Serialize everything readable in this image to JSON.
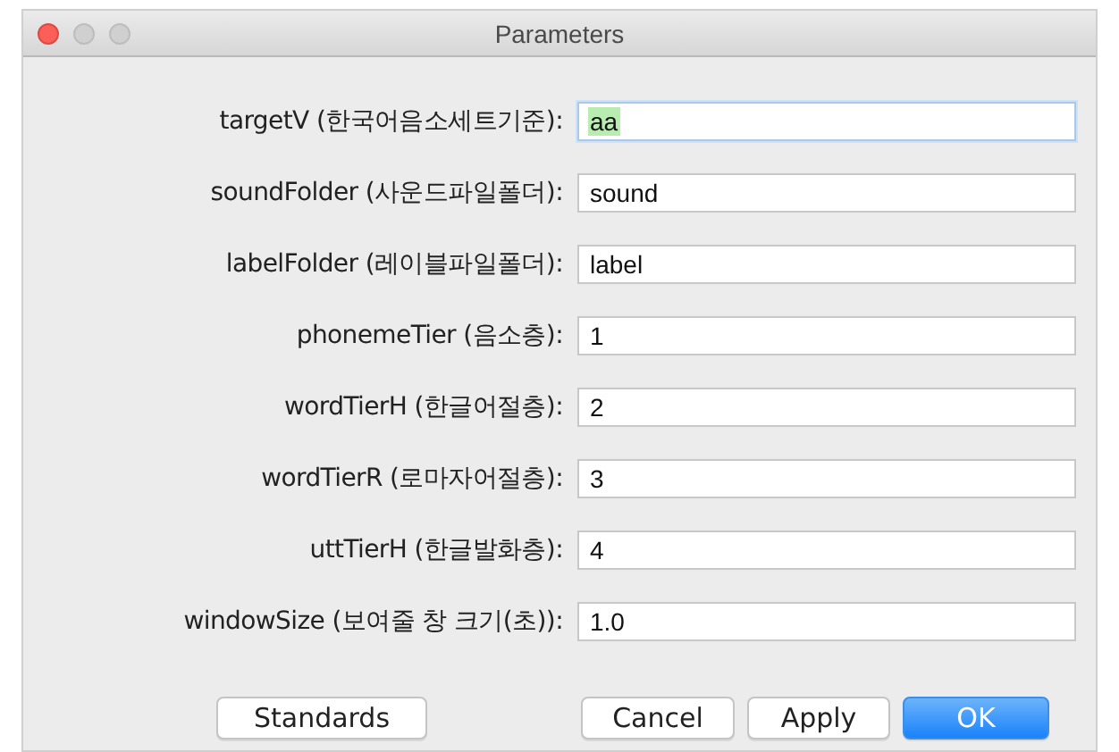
{
  "window": {
    "title": "Parameters"
  },
  "fields": [
    {
      "label": "targetV (한국어음소세트기준):",
      "value": "aa",
      "focused": true
    },
    {
      "label": "soundFolder (사운드파일폴더):",
      "value": "sound",
      "focused": false
    },
    {
      "label": "labelFolder (레이블파일폴더):",
      "value": "label",
      "focused": false
    },
    {
      "label": "phonemeTier (음소층):",
      "value": "1",
      "focused": false
    },
    {
      "label": "wordTierH (한글어절층):",
      "value": "2",
      "focused": false
    },
    {
      "label": "wordTierR (로마자어절층):",
      "value": "3",
      "focused": false
    },
    {
      "label": "uttTierH (한글발화층):",
      "value": "4",
      "focused": false
    },
    {
      "label": "windowSize (보여줄 창 크기(초)):",
      "value": "1.0",
      "focused": false
    }
  ],
  "left_buttons": [
    {
      "label": "Standards",
      "kind": "normal"
    }
  ],
  "right_buttons": [
    {
      "label": "Cancel",
      "kind": "normal"
    },
    {
      "label": "Apply",
      "kind": "normal"
    },
    {
      "label": "OK",
      "kind": "default"
    }
  ]
}
